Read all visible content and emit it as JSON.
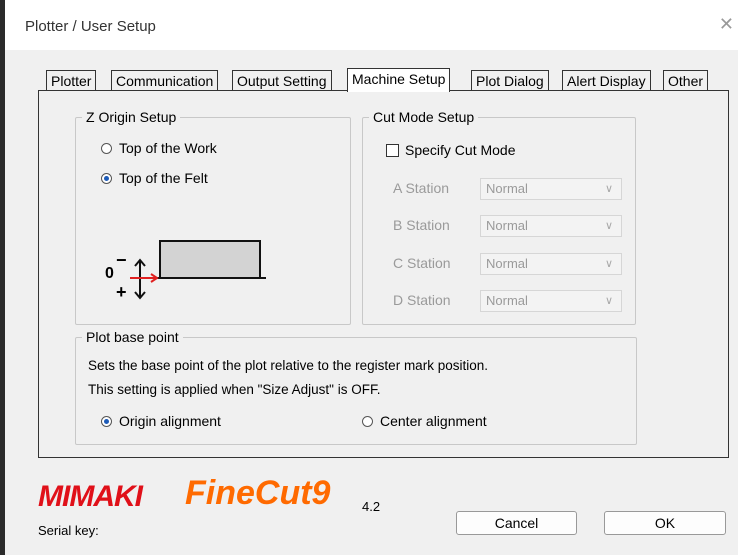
{
  "window": {
    "title": "Plotter / User Setup",
    "close_glyph": "✕"
  },
  "tabs": [
    {
      "label": "Plotter"
    },
    {
      "label": "Communication"
    },
    {
      "label": "Output Setting"
    },
    {
      "label": "Machine Setup"
    },
    {
      "label": "Plot Dialog"
    },
    {
      "label": "Alert Display"
    },
    {
      "label": "Other"
    }
  ],
  "active_tab": "Machine Setup",
  "z_origin": {
    "title": "Z Origin Setup",
    "options": [
      "Top of the Work",
      "Top of the Felt"
    ],
    "selected": "Top of the Felt",
    "diagram": {
      "zero_label": "0",
      "minus_label": "−",
      "plus_label": "+"
    }
  },
  "cut_mode": {
    "title": "Cut Mode Setup",
    "specify_label": "Specify Cut Mode",
    "specify_checked": false,
    "stations": [
      {
        "label": "A Station",
        "value": "Normal"
      },
      {
        "label": "B Station",
        "value": "Normal"
      },
      {
        "label": "C Station",
        "value": "Normal"
      },
      {
        "label": "D Station",
        "value": "Normal"
      }
    ]
  },
  "plot_base": {
    "title": "Plot base point",
    "line1": "Sets the base point of the plot relative to the register mark position.",
    "line2": "This setting is applied when \"Size Adjust\" is OFF.",
    "options": [
      "Origin alignment",
      "Center alignment"
    ],
    "selected": "Origin alignment"
  },
  "brand": {
    "maker": "MIMAKI",
    "product": "FineCut9",
    "version": "4.2"
  },
  "serial_label": "Serial key:",
  "buttons": {
    "cancel": "Cancel",
    "ok": "OK"
  },
  "colors": {
    "mimaki_red": "#e01019",
    "finecut_orange": "#ff6a00",
    "radio_blue": "#1d5bb8",
    "arrow_red": "#e02020"
  }
}
